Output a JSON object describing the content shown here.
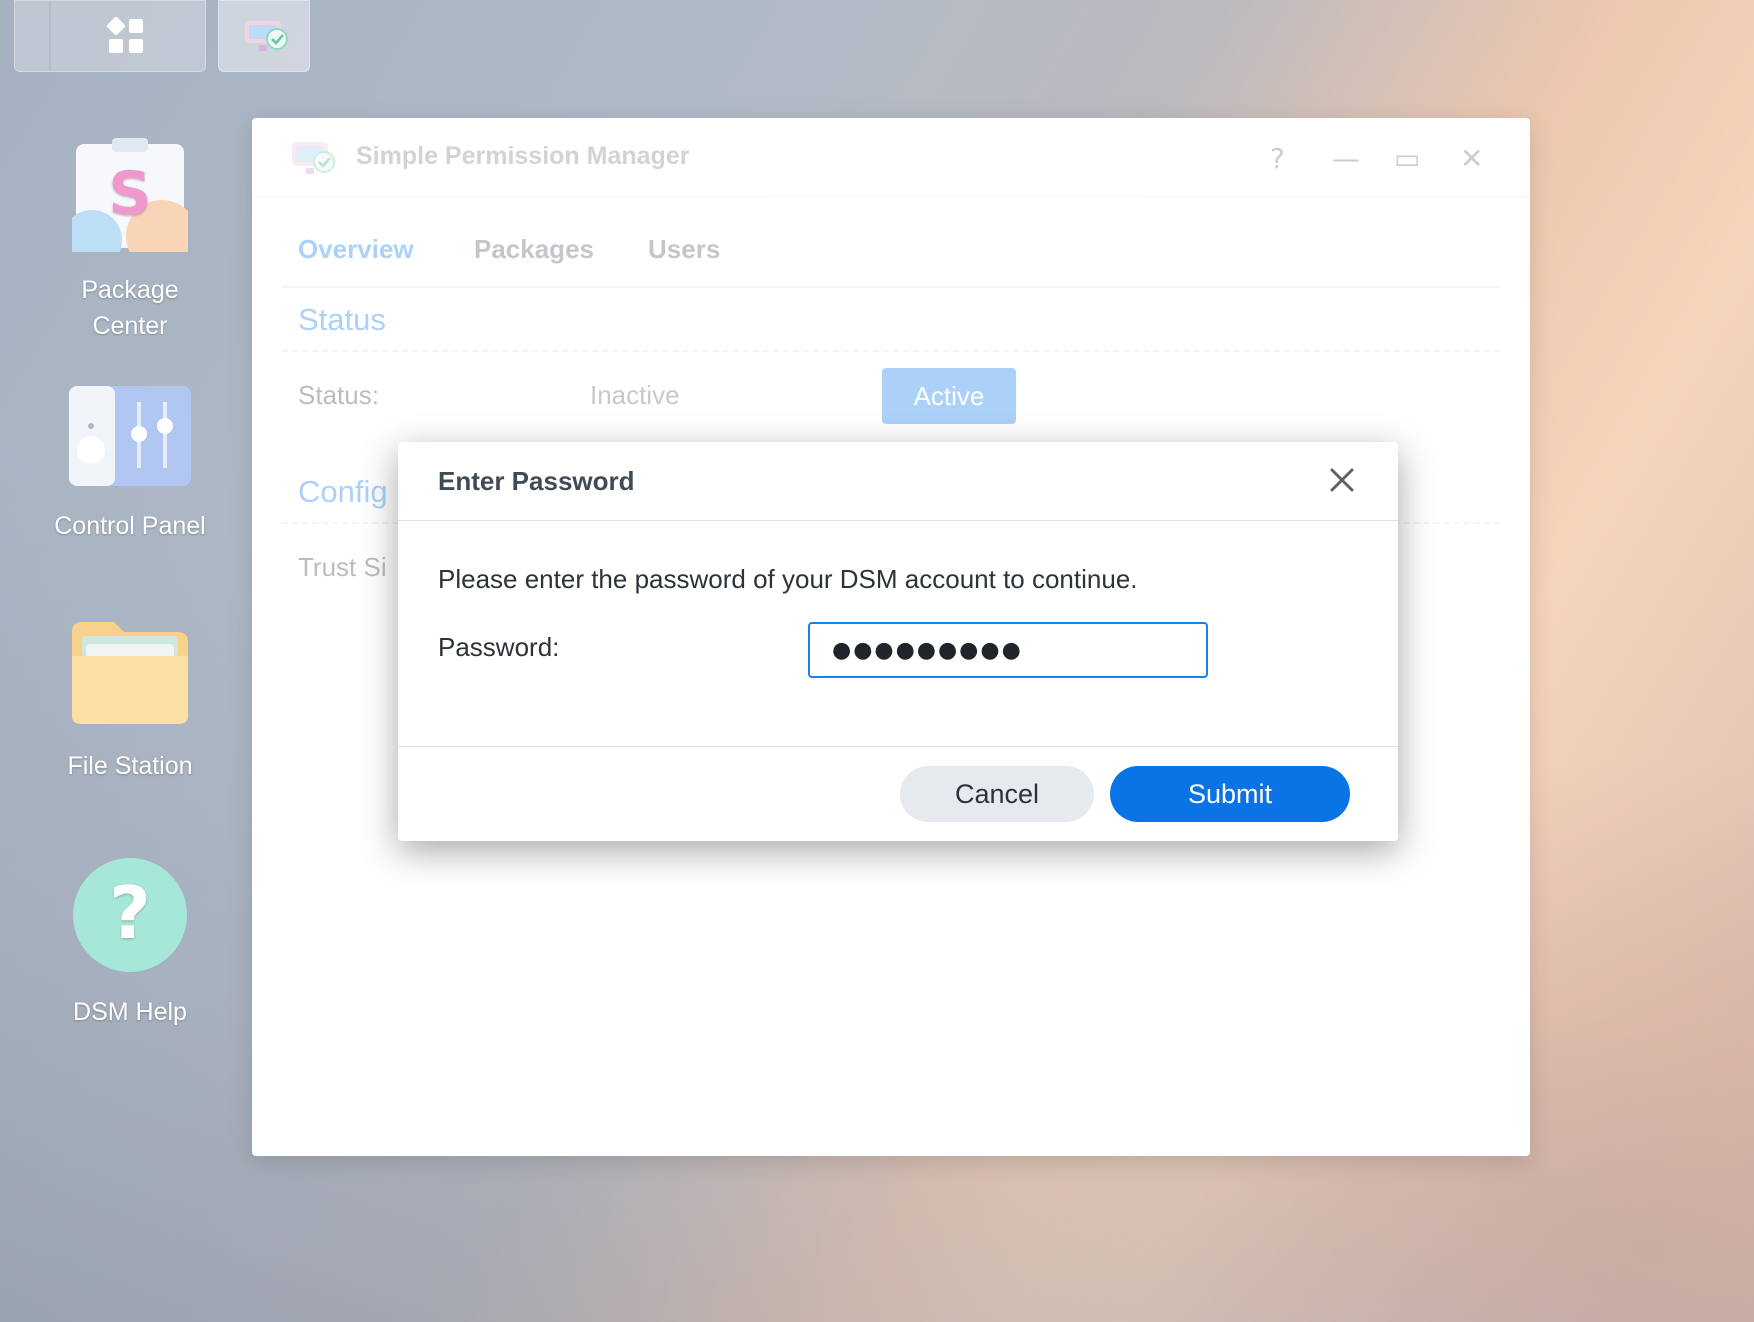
{
  "taskbar": {
    "main_menu_icon": "grid-icon",
    "app_icon": "simple-permission-manager-icon"
  },
  "desktop_icons": [
    {
      "label_line1": "Package",
      "label_line2": "Center",
      "icon": "package-center-icon"
    },
    {
      "label": "Control Panel",
      "icon": "control-panel-icon"
    },
    {
      "label": "File Station",
      "icon": "file-station-icon"
    },
    {
      "label": "DSM Help",
      "icon": "dsm-help-icon"
    }
  ],
  "window": {
    "title": "Simple Permission Manager",
    "controls": {
      "help": "?",
      "minimize": "—",
      "maximize": "▭",
      "close": "✕"
    },
    "tabs": [
      {
        "label": "Overview",
        "active": true
      },
      {
        "label": "Packages",
        "active": false
      },
      {
        "label": "Users",
        "active": false
      }
    ],
    "status_section": {
      "title": "Status",
      "status_label": "Status:",
      "option_inactive": "Inactive",
      "option_active": "Active"
    },
    "config_section": {
      "title_visible": "Config",
      "trust_label_visible": "Trust Si"
    }
  },
  "modal": {
    "title": "Enter Password",
    "message": "Please enter the password of your DSM account to continue.",
    "password_label": "Password:",
    "password_value": "●●●●●●●●●",
    "cancel_label": "Cancel",
    "submit_label": "Submit"
  },
  "colors": {
    "accent": "#1681f0",
    "submit": "#0a74e6",
    "cancel_bg": "#e6eaee"
  }
}
